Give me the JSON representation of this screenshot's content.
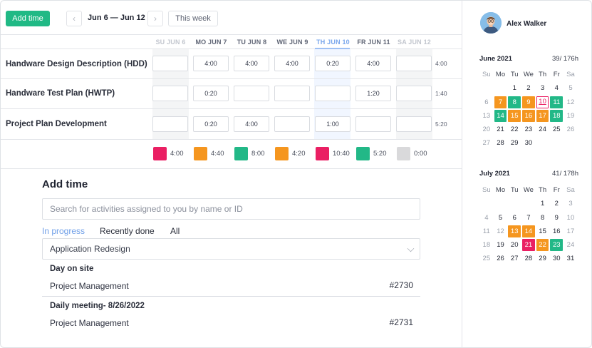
{
  "toolbar": {
    "add_time_label": "Add time",
    "prev_icon": "chevron-left-icon",
    "next_icon": "chevron-right-icon",
    "range_label": "Jun 6 — Jun 12",
    "this_week_label": "This week"
  },
  "days": [
    {
      "label": "SU JUN 6",
      "kind": "weekend"
    },
    {
      "label": "MO JUN 7",
      "kind": "normal"
    },
    {
      "label": "TU JUN 8",
      "kind": "normal"
    },
    {
      "label": "WE JUN 9",
      "kind": "normal"
    },
    {
      "label": "TH JUN 10",
      "kind": "today"
    },
    {
      "label": "FR JUN 11",
      "kind": "normal"
    },
    {
      "label": "SA JUN 12",
      "kind": "weekend"
    }
  ],
  "tasks": [
    {
      "name": "Handware Design Description (HDD)",
      "cells": [
        "",
        "4:00",
        "4:00",
        "4:00",
        "0:20",
        "4:00",
        ""
      ],
      "total": "4:00"
    },
    {
      "name": "Handware Test Plan (HWTP)",
      "cells": [
        "",
        "0:20",
        "",
        "",
        "",
        "1:20",
        ""
      ],
      "total": "1:40"
    },
    {
      "name": "Project Plan Development",
      "cells": [
        "",
        "0:20",
        "4:00",
        "",
        "1:00",
        "",
        ""
      ],
      "total": "5:20"
    }
  ],
  "daily_totals": [
    {
      "value": "4:00",
      "color": "#ea1f63"
    },
    {
      "value": "4:40",
      "color": "#f5961f"
    },
    {
      "value": "8:00",
      "color": "#22b887"
    },
    {
      "value": "4:20",
      "color": "#f5961f"
    },
    {
      "value": "10:40",
      "color": "#ea1f63"
    },
    {
      "value": "5:20",
      "color": "#22b887"
    },
    {
      "value": "0:00",
      "color": "#d9d9db"
    }
  ],
  "add_time": {
    "title": "Add time",
    "search_placeholder": "Search for activities assigned to you by name or ID",
    "tabs": [
      "In progress",
      "Recently done",
      "All"
    ],
    "project_select": "Application Redesign",
    "groups": [
      {
        "title": "Day on site",
        "item": "Project Management",
        "id": "#2730"
      },
      {
        "title": "Daily meeting- 8/26/2022",
        "item": "Project Management",
        "id": "#2731"
      }
    ]
  },
  "user": {
    "name": "Alex Walker"
  },
  "weekday_headers": [
    "Su",
    "Mo",
    "Tu",
    "We",
    "Th",
    "Fr",
    "Sa"
  ],
  "calendars": [
    {
      "title": "June 2021",
      "hours": "39/ 176h",
      "weeks": [
        [
          {
            "d": "",
            "s": ""
          },
          {
            "d": "",
            "s": ""
          },
          {
            "d": "1",
            "s": ""
          },
          {
            "d": "2",
            "s": ""
          },
          {
            "d": "3",
            "s": ""
          },
          {
            "d": "4",
            "s": ""
          },
          {
            "d": "5",
            "s": "wk"
          }
        ],
        [
          {
            "d": "6",
            "s": "wk"
          },
          {
            "d": "7",
            "s": "orange"
          },
          {
            "d": "8",
            "s": "green"
          },
          {
            "d": "9",
            "s": "orange"
          },
          {
            "d": "10",
            "s": "today"
          },
          {
            "d": "11",
            "s": "green"
          },
          {
            "d": "12",
            "s": "wk"
          }
        ],
        [
          {
            "d": "13",
            "s": "wk"
          },
          {
            "d": "14",
            "s": "green"
          },
          {
            "d": "15",
            "s": "orange"
          },
          {
            "d": "16",
            "s": "orange"
          },
          {
            "d": "17",
            "s": "orange"
          },
          {
            "d": "18",
            "s": "green"
          },
          {
            "d": "19",
            "s": "wk"
          }
        ],
        [
          {
            "d": "20",
            "s": "wk"
          },
          {
            "d": "21",
            "s": ""
          },
          {
            "d": "22",
            "s": ""
          },
          {
            "d": "23",
            "s": ""
          },
          {
            "d": "24",
            "s": ""
          },
          {
            "d": "25",
            "s": ""
          },
          {
            "d": "26",
            "s": "wk"
          }
        ],
        [
          {
            "d": "27",
            "s": "wk"
          },
          {
            "d": "28",
            "s": ""
          },
          {
            "d": "29",
            "s": ""
          },
          {
            "d": "30",
            "s": ""
          },
          {
            "d": "",
            "s": ""
          },
          {
            "d": "",
            "s": ""
          },
          {
            "d": "",
            "s": ""
          }
        ]
      ]
    },
    {
      "title": "July 2021",
      "hours": "41/ 178h",
      "weeks": [
        [
          {
            "d": "",
            "s": ""
          },
          {
            "d": "",
            "s": ""
          },
          {
            "d": "",
            "s": ""
          },
          {
            "d": "",
            "s": ""
          },
          {
            "d": "1",
            "s": ""
          },
          {
            "d": "2",
            "s": ""
          },
          {
            "d": "3",
            "s": "wk"
          }
        ],
        [
          {
            "d": "4",
            "s": "wk"
          },
          {
            "d": "5",
            "s": ""
          },
          {
            "d": "6",
            "s": ""
          },
          {
            "d": "7",
            "s": ""
          },
          {
            "d": "8",
            "s": ""
          },
          {
            "d": "9",
            "s": ""
          },
          {
            "d": "10",
            "s": "wk"
          }
        ],
        [
          {
            "d": "11",
            "s": "wk"
          },
          {
            "d": "12",
            "s": "muted"
          },
          {
            "d": "13",
            "s": "orange"
          },
          {
            "d": "14",
            "s": "orange"
          },
          {
            "d": "15",
            "s": ""
          },
          {
            "d": "16",
            "s": ""
          },
          {
            "d": "17",
            "s": "wk"
          }
        ],
        [
          {
            "d": "18",
            "s": "wk"
          },
          {
            "d": "19",
            "s": ""
          },
          {
            "d": "20",
            "s": ""
          },
          {
            "d": "21",
            "s": "pink"
          },
          {
            "d": "22",
            "s": "orange"
          },
          {
            "d": "23",
            "s": "green"
          },
          {
            "d": "24",
            "s": "wk"
          }
        ],
        [
          {
            "d": "25",
            "s": "wk"
          },
          {
            "d": "26",
            "s": ""
          },
          {
            "d": "27",
            "s": ""
          },
          {
            "d": "28",
            "s": ""
          },
          {
            "d": "29",
            "s": ""
          },
          {
            "d": "30",
            "s": ""
          },
          {
            "d": "31",
            "s": ""
          }
        ]
      ]
    }
  ]
}
